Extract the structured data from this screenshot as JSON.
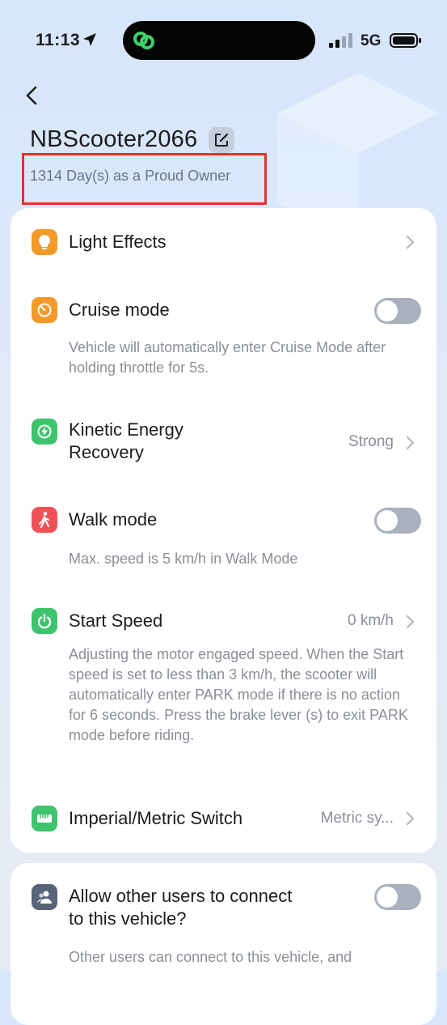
{
  "status_bar": {
    "time": "11:13",
    "network": "5G"
  },
  "header": {
    "title": "NBScooter2066",
    "owner_text": "1314 Day(s) as a Proud Owner"
  },
  "settings": {
    "light_effects": {
      "label": "Light Effects"
    },
    "cruise_mode": {
      "label": "Cruise mode",
      "enabled": false,
      "description": "Vehicle will automatically enter Cruise Mode after holding throttle for 5s."
    },
    "kinetic_energy_recovery": {
      "label": "Kinetic Energy Recovery",
      "value": "Strong"
    },
    "walk_mode": {
      "label": "Walk mode",
      "enabled": false,
      "description": "Max. speed is 5 km/h in Walk Mode"
    },
    "start_speed": {
      "label": "Start Speed",
      "value": "0 km/h",
      "description": "Adjusting the motor engaged speed. When the Start speed is set to less than 3 km/h, the scooter will automatically enter PARK mode if there is no action for 6 seconds. Press the brake lever (s) to exit PARK mode before riding."
    },
    "units": {
      "label": "Imperial/Metric Switch",
      "value": "Metric sy..."
    },
    "allow_users": {
      "label": "Allow other users to connect to this vehicle?",
      "enabled": false,
      "description": "Other users can connect to this vehicle, and"
    }
  },
  "colors": {
    "orange": "#f39a2b",
    "green": "#3ec46d",
    "red": "#ef5157",
    "slate": "#5a6478",
    "highlight": "#e0342b"
  }
}
